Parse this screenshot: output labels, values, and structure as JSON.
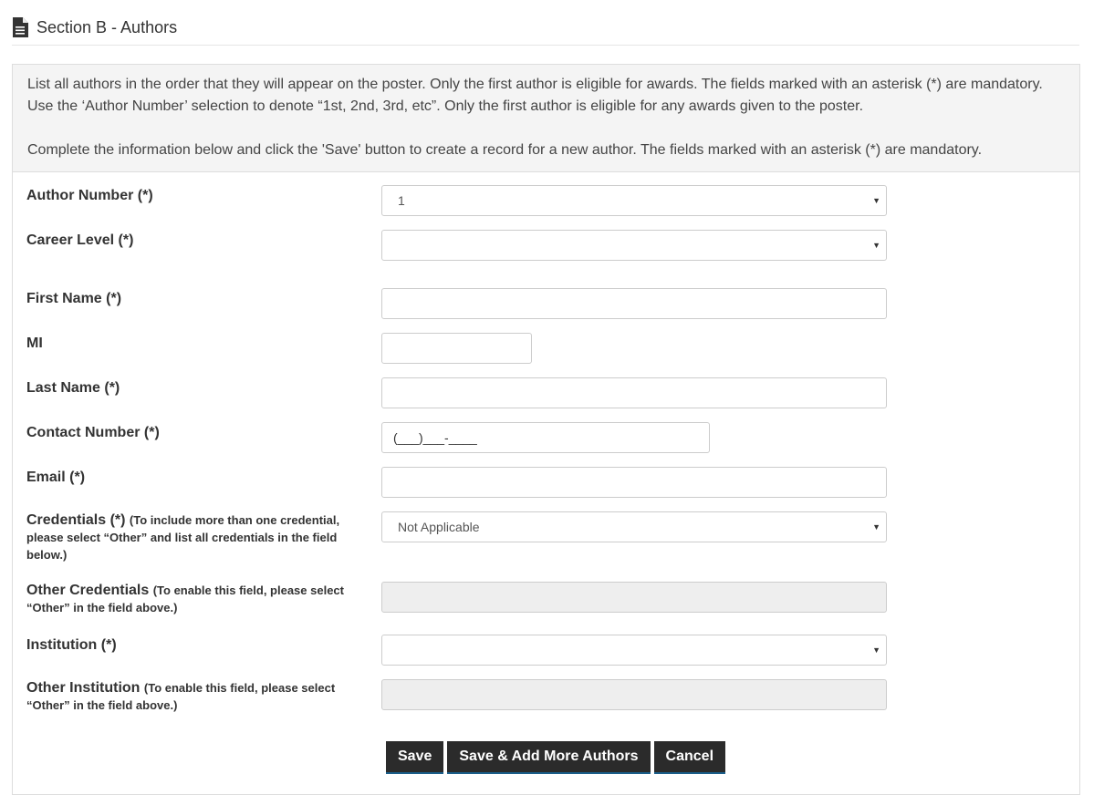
{
  "header": {
    "title": "Section B - Authors",
    "icon": "document-icon"
  },
  "instructions": {
    "line1": "List all authors in the order that they will appear on the poster. Only the first author is eligible for awards. The fields marked with an asterisk (*) are mandatory. Use the ‘Author Number’ selection to denote “1st, 2nd, 3rd, etc”. Only the first author is eligible for any awards given to the poster.",
    "line2": "Complete the information below and click the 'Save' button to create a record for a new author. The fields marked with an asterisk (*) are mandatory."
  },
  "fields": {
    "author_number": {
      "label": "Author Number (*)",
      "value": "1"
    },
    "career_level": {
      "label": "Career Level (*)",
      "value": ""
    },
    "first_name": {
      "label": "First Name (*)",
      "value": ""
    },
    "mi": {
      "label": "MI",
      "value": ""
    },
    "last_name": {
      "label": "Last Name (*)",
      "value": ""
    },
    "contact_number": {
      "label": "Contact Number (*)",
      "value": "(___)___-____"
    },
    "email": {
      "label": "Email (*)",
      "value": ""
    },
    "credentials": {
      "label": "Credentials (*)",
      "hint": "(To include more than one credential, please select “Other” and list all credentials in the field below.)",
      "value": "Not Applicable"
    },
    "other_credentials": {
      "label": "Other Credentials",
      "hint": "(To enable this field, please select “Other” in the field above.)",
      "value": ""
    },
    "institution": {
      "label": "Institution (*)",
      "value": ""
    },
    "other_institution": {
      "label": "Other Institution",
      "hint": "(To enable this field, please select “Other” in the field above.)",
      "value": ""
    }
  },
  "buttons": {
    "save": "Save",
    "save_add": "Save & Add More Authors",
    "cancel": "Cancel"
  },
  "colors": {
    "button_bg": "#2b2b2b",
    "panel_bg": "#f4f4f4",
    "disabled_bg": "#eeeeee"
  }
}
